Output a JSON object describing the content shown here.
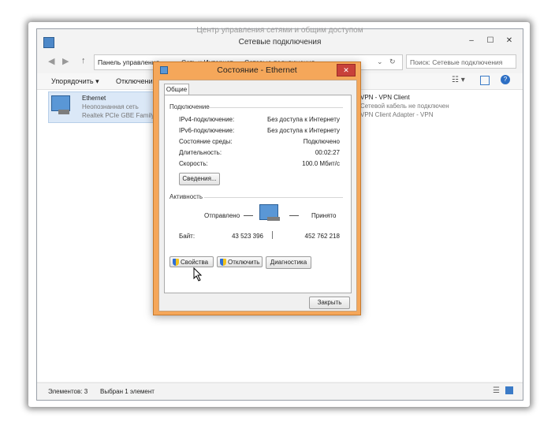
{
  "background_window": {
    "ghost_title": "Центр управления сетями и общим доступом",
    "title": "Сетевые подключения",
    "breadcrumb": [
      "Панель управления",
      "Сеть и Интернет",
      "Сетевые подключения"
    ],
    "search_placeholder": "Поиск: Сетевые подключения",
    "commands": {
      "organize": "Упорядочить",
      "disable": "Отключение"
    },
    "connections": [
      {
        "name": "Ethernet",
        "status": "Неопознанная сеть",
        "adapter": "Realtek PCIe GBE Family C"
      },
      {
        "name": "VPN - VPN Client",
        "status": "Сетевой кабель не подключен",
        "adapter": "VPN Client Adapter - VPN"
      }
    ],
    "statusbar": {
      "items": "Элементов: 3",
      "selected": "Выбран 1 элемент"
    }
  },
  "dialog": {
    "title": "Состояние - Ethernet",
    "tab": "Общие",
    "connection_section": "Подключение",
    "rows": [
      {
        "label": "IPv4-подключение:",
        "value": "Без доступа к Интернету"
      },
      {
        "label": "IPv6-подключение:",
        "value": "Без доступа к Интернету"
      },
      {
        "label": "Состояние среды:",
        "value": "Подключено"
      },
      {
        "label": "Длительность:",
        "value": "00:02:27"
      },
      {
        "label": "Скорость:",
        "value": "100.0 Мбит/с"
      }
    ],
    "details_button": "Сведения...",
    "activity_section": "Активность",
    "sent_label": "Отправлено",
    "received_label": "Принято",
    "bytes_label": "Байт:",
    "bytes_sent": "43 523 396",
    "bytes_received": "452 762 218",
    "buttons": {
      "properties": "Свойства",
      "disable": "Отключить",
      "diagnose": "Диагностика"
    },
    "close_button": "Закрыть"
  }
}
